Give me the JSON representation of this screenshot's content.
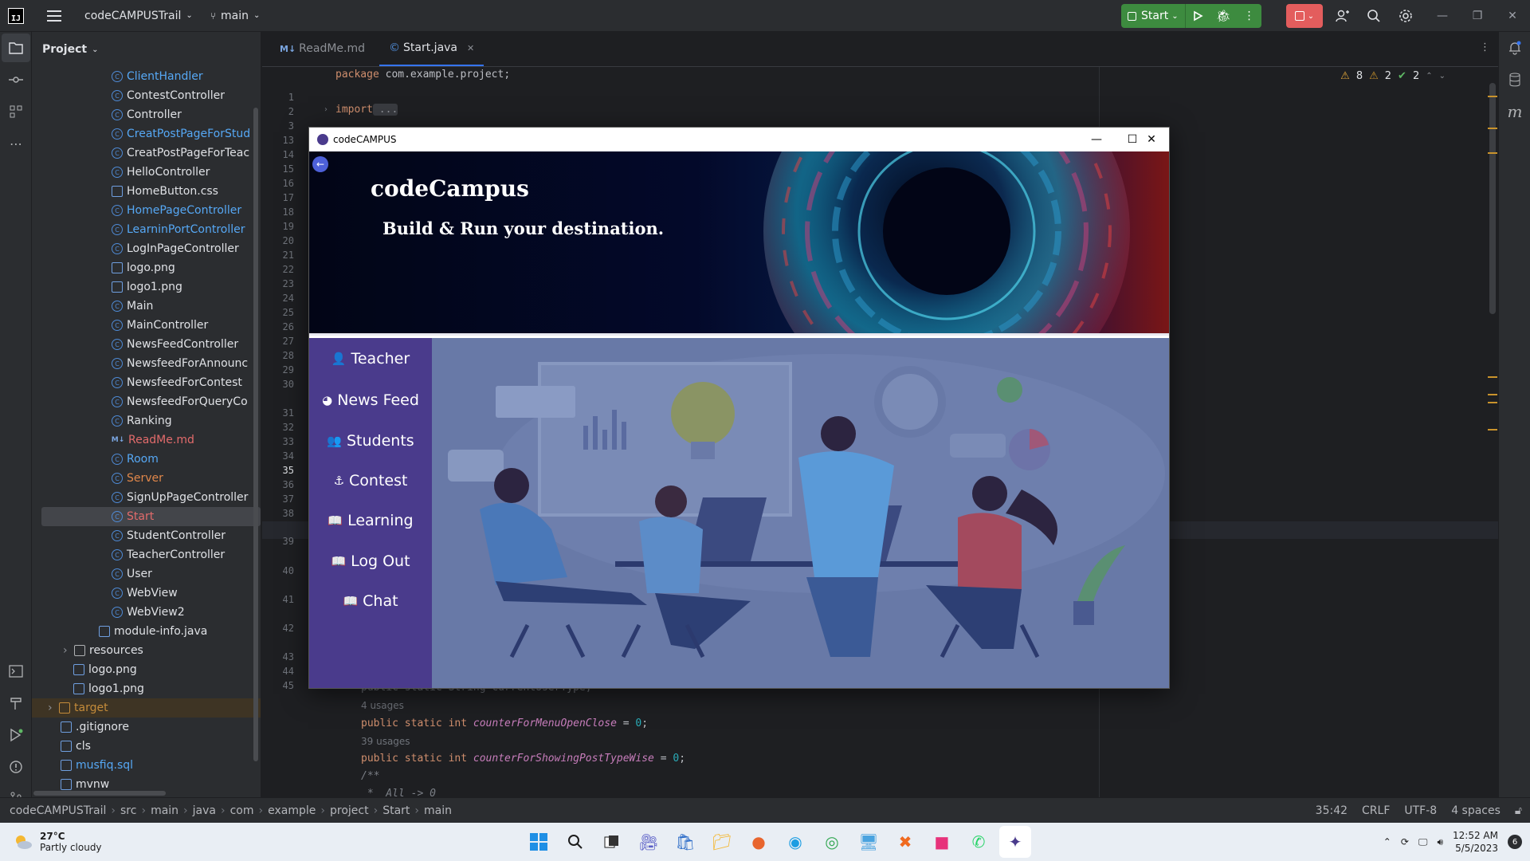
{
  "titlebar": {
    "logo_text": "IJ",
    "project_name": "codeCAMPUSTrail",
    "branch": "main",
    "run_config": "Start"
  },
  "project_panel": {
    "title": "Project",
    "items": [
      {
        "label": "ClientHandler",
        "indent": 3,
        "icon": "class",
        "color": "#56a8f5"
      },
      {
        "label": "ContestController",
        "indent": 3,
        "icon": "class",
        "color": "#dfe1e5"
      },
      {
        "label": "Controller",
        "indent": 3,
        "icon": "class",
        "color": "#dfe1e5"
      },
      {
        "label": "CreatPostPageForStud",
        "indent": 3,
        "icon": "class",
        "color": "#56a8f5"
      },
      {
        "label": "CreatPostPageForTeac",
        "indent": 3,
        "icon": "class",
        "color": "#dfe1e5"
      },
      {
        "label": "HelloController",
        "indent": 3,
        "icon": "class",
        "color": "#dfe1e5"
      },
      {
        "label": "HomeButton.css",
        "indent": 3,
        "icon": "file",
        "color": "#dfe1e5"
      },
      {
        "label": "HomePageController",
        "indent": 3,
        "icon": "class",
        "color": "#56a8f5"
      },
      {
        "label": "LearninPortController",
        "indent": 3,
        "icon": "class",
        "color": "#56a8f5"
      },
      {
        "label": "LogInPageController",
        "indent": 3,
        "icon": "class",
        "color": "#dfe1e5"
      },
      {
        "label": "logo.png",
        "indent": 3,
        "icon": "file",
        "color": "#dfe1e5"
      },
      {
        "label": "logo1.png",
        "indent": 3,
        "icon": "file",
        "color": "#dfe1e5"
      },
      {
        "label": "Main",
        "indent": 3,
        "icon": "class",
        "color": "#dfe1e5"
      },
      {
        "label": "MainController",
        "indent": 3,
        "icon": "class",
        "color": "#dfe1e5"
      },
      {
        "label": "NewsFeedController",
        "indent": 3,
        "icon": "class",
        "color": "#dfe1e5"
      },
      {
        "label": "NewsfeedForAnnounc",
        "indent": 3,
        "icon": "class",
        "color": "#dfe1e5"
      },
      {
        "label": "NewsfeedForContest",
        "indent": 3,
        "icon": "class",
        "color": "#dfe1e5"
      },
      {
        "label": "NewsfeedForQueryCo",
        "indent": 3,
        "icon": "class",
        "color": "#dfe1e5"
      },
      {
        "label": "Ranking",
        "indent": 3,
        "icon": "class",
        "color": "#dfe1e5"
      },
      {
        "label": "ReadMe.md",
        "indent": 3,
        "icon": "md",
        "color": "#e26b6b"
      },
      {
        "label": "Room",
        "indent": 3,
        "icon": "class",
        "color": "#56a8f5"
      },
      {
        "label": "Server",
        "indent": 3,
        "icon": "class",
        "color": "#e0874a"
      },
      {
        "label": "SignUpPageController",
        "indent": 3,
        "icon": "class",
        "color": "#dfe1e5"
      },
      {
        "label": "Start",
        "indent": 3,
        "icon": "class",
        "color": "#e26b6b",
        "selected": true
      },
      {
        "label": "StudentController",
        "indent": 3,
        "icon": "class",
        "color": "#dfe1e5"
      },
      {
        "label": "TeacherController",
        "indent": 3,
        "icon": "class",
        "color": "#dfe1e5"
      },
      {
        "label": "User",
        "indent": 3,
        "icon": "class",
        "color": "#dfe1e5"
      },
      {
        "label": "WebView",
        "indent": 3,
        "icon": "class",
        "color": "#dfe1e5"
      },
      {
        "label": "WebView2",
        "indent": 3,
        "icon": "class",
        "color": "#dfe1e5"
      },
      {
        "label": "module-info.java",
        "indent": 2,
        "icon": "file",
        "color": "#dfe1e5"
      },
      {
        "label": "resources",
        "indent": 1,
        "icon": "folder",
        "color": "#dfe1e5",
        "arrow": true
      },
      {
        "label": "logo.png",
        "indent": 0,
        "icon": "file",
        "color": "#dfe1e5"
      },
      {
        "label": "logo1.png",
        "indent": 0,
        "icon": "file",
        "color": "#dfe1e5"
      },
      {
        "label": "target",
        "indent": -1,
        "icon": "folder-orange",
        "color": "#c48b3a",
        "arrow": true,
        "target": true
      },
      {
        "label": ".gitignore",
        "indent": -1,
        "icon": "file",
        "color": "#dfe1e5"
      },
      {
        "label": "cls",
        "indent": -1,
        "icon": "file",
        "color": "#dfe1e5"
      },
      {
        "label": "musfiq.sql",
        "indent": -1,
        "icon": "file",
        "color": "#56a8f5"
      },
      {
        "label": "mvnw",
        "indent": -1,
        "icon": "file",
        "color": "#dfe1e5"
      }
    ]
  },
  "editor": {
    "tabs": [
      {
        "label": "ReadMe.md",
        "prefix": "M↓",
        "active": false
      },
      {
        "label": "Start.java",
        "prefix": "©",
        "active": true,
        "close": "✕"
      }
    ],
    "inspections": {
      "warnings": "8",
      "weak": "2",
      "ok": "2"
    },
    "line_numbers": [
      "1",
      "2",
      "3",
      "13",
      "14",
      "15",
      "16",
      "17",
      "18",
      "19",
      "20",
      "21",
      "22",
      "23",
      "24",
      "25",
      "26",
      "27",
      "28",
      "29",
      "30",
      "31",
      "32",
      "33",
      "34",
      "35",
      "36",
      "37",
      "38",
      "39",
      "40",
      "41",
      "42",
      "43",
      "44",
      "45"
    ],
    "current_line": "35",
    "code": {
      "l1_kw": "package",
      "l1_rest": " com.example.project;",
      "l3_kw": "import",
      "l3_rest": " ...",
      "l41_rest": "public static String currentUserType;",
      "usage_41": "4 usages",
      "l42_kw": "public static int",
      "l42_field": "counterForMenuOpenClose",
      "l42_eq": " = ",
      "l42_num": "0",
      "l42_end": ";",
      "usage_42": "39 usages",
      "l43_kw": "public static int",
      "l43_field": "counterForShowingPostTypeWise",
      "l43_eq": " = ",
      "l43_num": "0",
      "l43_end": ";",
      "l44": "/**",
      "l45": " *  All -> 0"
    }
  },
  "statusbar": {
    "crumbs": [
      "codeCAMPUSTrail",
      "src",
      "main",
      "java",
      "com",
      "example",
      "project",
      "Start",
      "main"
    ],
    "position": "35:42",
    "line_sep": "CRLF",
    "encoding": "UTF-8",
    "indent": "4 spaces"
  },
  "app": {
    "window_title": "codeCAMPUS",
    "brand": "codeCampus",
    "tagline": "Build & Run your destination.",
    "menu": [
      {
        "label": "Teacher",
        "icon": "👤"
      },
      {
        "label": "News Feed",
        "icon": "◕"
      },
      {
        "label": "Students",
        "icon": "👥"
      },
      {
        "label": "Contest",
        "icon": "⚓"
      },
      {
        "label": "Learning",
        "icon": "📖"
      },
      {
        "label": "Log Out",
        "icon": "📖"
      },
      {
        "label": "Chat",
        "icon": "📖"
      }
    ]
  },
  "taskbar": {
    "temperature": "27°C",
    "weather": "Partly cloudy",
    "time": "12:52 AM",
    "date": "5/5/2023",
    "notification_count": "6"
  },
  "colors": {
    "accent": "#3574f0",
    "run_green": "#3d8b3f",
    "stop_red": "#e35d5d",
    "app_menu_purple": "#4a3b8c"
  }
}
